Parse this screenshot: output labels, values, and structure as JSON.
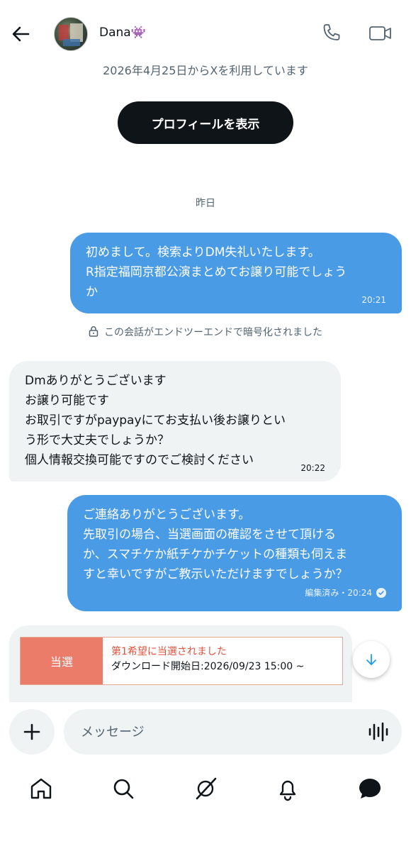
{
  "header": {
    "contact_name": "Dana👾"
  },
  "joined_text": "2026年4月25日からXを利用しています",
  "profile_button": "プロフィールを表示",
  "date_separator": "昨日",
  "encryption_notice": "この会話がエンドツーエンドで暗号化されました",
  "messages": [
    {
      "direction": "outgoing",
      "lines": [
        "初めまして。検索よりDM失礼いたします。",
        "R指定福岡京都公演まとめてお譲り可能でしょう",
        "か"
      ],
      "time": "20:21"
    },
    {
      "direction": "incoming",
      "lines": [
        "Dmありがとうございます",
        "お譲り可能です",
        "お取引ですがpaypayにてお支払い後お譲りとい",
        "う形で大丈夫でしょうか？",
        "個人情報交換可能ですのでご検討ください"
      ],
      "time": "20:22"
    },
    {
      "direction": "outgoing",
      "lines": [
        "ご連絡ありがとうございます。",
        "先取引の場合、当選画面の確認をさせて頂ける",
        "か、スマチケか紙チケかチケットの種類も伺えま",
        "すと幸いですがご教示いただけますでしょうか？"
      ],
      "edited_label": "編集済み・20:24"
    }
  ],
  "ticket_card": {
    "badge": "当選",
    "title": "第1希望に当選されました",
    "detail": "ダウンロード開始日:2026/09/23 15:00 ~"
  },
  "composer": {
    "placeholder": "メッセージ"
  },
  "tabs": [
    "home-icon",
    "search-icon",
    "grok-icon",
    "notifications-icon",
    "messages-icon"
  ],
  "colors": {
    "outgoing_bubble": "#4a9be6",
    "incoming_bubble": "#eff3f4",
    "badge": "#ec7c6a"
  }
}
